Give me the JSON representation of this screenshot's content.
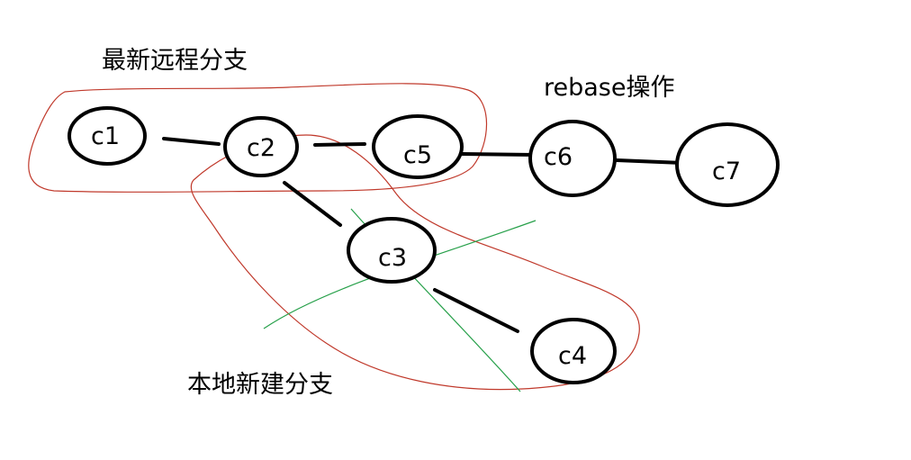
{
  "labels": {
    "remote_branch": "最新远程分支",
    "rebase_op": "rebase操作",
    "local_branch": "本地新建分支"
  },
  "nodes": [
    {
      "id": "c1",
      "label": "c1"
    },
    {
      "id": "c2",
      "label": "c2"
    },
    {
      "id": "c5",
      "label": "c5"
    },
    {
      "id": "c6",
      "label": "c6"
    },
    {
      "id": "c7",
      "label": "c7"
    },
    {
      "id": "c3",
      "label": "c3"
    },
    {
      "id": "c4",
      "label": "c4"
    }
  ],
  "edges": [
    {
      "from": "c1",
      "to": "c2"
    },
    {
      "from": "c2",
      "to": "c5"
    },
    {
      "from": "c5",
      "to": "c6"
    },
    {
      "from": "c6",
      "to": "c7"
    },
    {
      "from": "c2",
      "to": "c3"
    },
    {
      "from": "c3",
      "to": "c4"
    }
  ],
  "colors": {
    "node_stroke": "#000000",
    "edge": "#000000",
    "remote_loop": "#c0392b",
    "local_loop": "#c0392b",
    "cross_mark": "#27a04a"
  }
}
